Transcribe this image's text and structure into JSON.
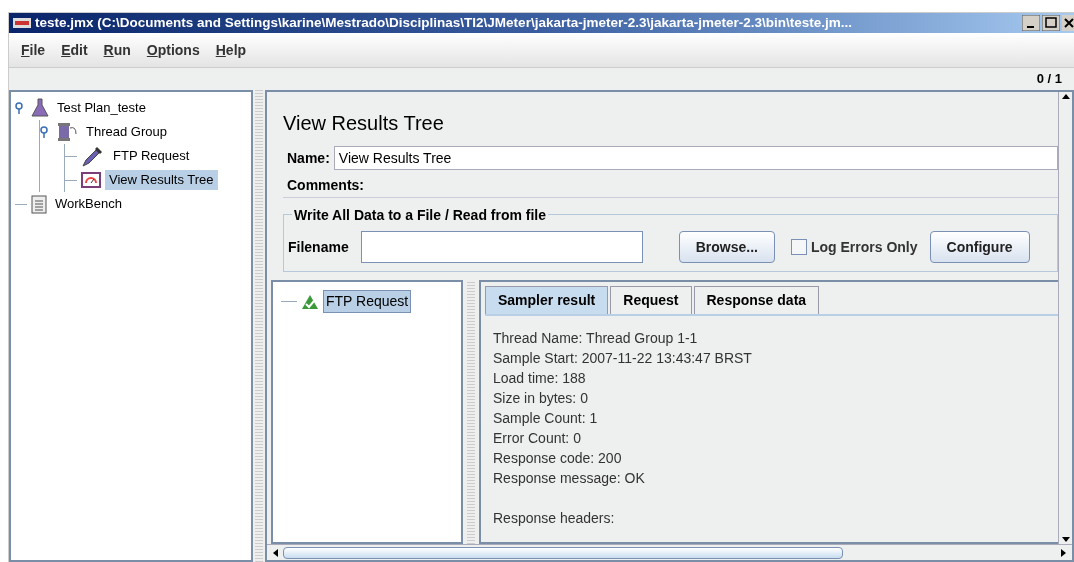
{
  "window": {
    "title": "teste.jmx (C:\\Documents and Settings\\karine\\Mestrado\\Disciplinas\\TI2\\JMeter\\jakarta-jmeter-2.3\\jakarta-jmeter-2.3\\bin\\teste.jm..."
  },
  "menu": [
    {
      "label": "File"
    },
    {
      "label": "Edit"
    },
    {
      "label": "Run"
    },
    {
      "label": "Options"
    },
    {
      "label": "Help"
    }
  ],
  "counter": "0 / 1",
  "tree": [
    {
      "label": "Test Plan_teste",
      "kind": "plan",
      "selected": false,
      "expanded": true,
      "children": [
        {
          "label": "Thread Group",
          "kind": "thread",
          "selected": false,
          "expanded": true,
          "children": [
            {
              "label": "FTP Request",
              "kind": "sampler",
              "selected": false
            },
            {
              "label": "View Results Tree",
              "kind": "listener",
              "selected": true
            }
          ]
        }
      ]
    },
    {
      "label": "WorkBench",
      "kind": "workbench",
      "selected": false
    }
  ],
  "panel": {
    "title": "View Results Tree",
    "name_label": "Name:",
    "name_value": "View Results Tree",
    "comments_label": "Comments:",
    "file_group": {
      "title": "Write All Data to a File / Read from file",
      "filename_label": "Filename",
      "browse": "Browse...",
      "log_errors": {
        "label": "Log Errors Only",
        "checked": false
      },
      "configure": "Configure"
    }
  },
  "results_tree": [
    {
      "label": "FTP Request",
      "selected": true
    }
  ],
  "tabs": [
    {
      "label": "Sampler result",
      "selected": true
    },
    {
      "label": "Request",
      "selected": false
    },
    {
      "label": "Response data",
      "selected": false
    }
  ],
  "sampler_lines": [
    "Thread Name: Thread Group 1-1",
    "Sample Start: 2007-11-22 13:43:47 BRST",
    "Load time: 188",
    "Size in bytes: 0",
    "Sample Count: 1",
    "Error Count: 0",
    "Response code: 200",
    "Response message: OK"
  ],
  "headers_label": "Response headers:"
}
